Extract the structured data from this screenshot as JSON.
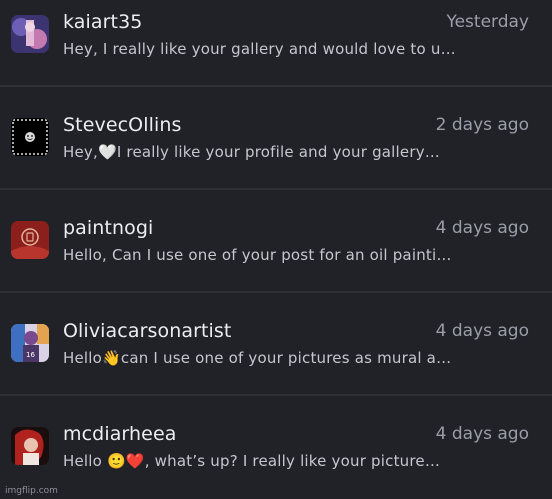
{
  "messages": [
    {
      "username": "kaiart35",
      "time": "Yesterday",
      "preview": "Hey, I really like your gallery and would love to u…"
    },
    {
      "username": "StevecOllins",
      "time": "2 days ago",
      "preview": "Hey,🤍I really like your profile and your gallery…"
    },
    {
      "username": "paintnogi",
      "time": "4 days ago",
      "preview": "Hello, Can I use one of your post for an oil painti…"
    },
    {
      "username": "Oliviacarsonartist",
      "time": "4 days ago",
      "preview": "Hello👋can I use one of your pictures as mural a…"
    },
    {
      "username": "mcdiarheea",
      "time": "4 days ago",
      "preview": "Hello 🙂❤️, what’s up? I really like your picture…"
    }
  ],
  "watermark": "imgflip.com",
  "colors": {
    "background": "#202228",
    "divider": "#2e3037",
    "username": "#ebedf2",
    "timestamp": "#9a9ea8",
    "preview": "#c4c7cf"
  }
}
